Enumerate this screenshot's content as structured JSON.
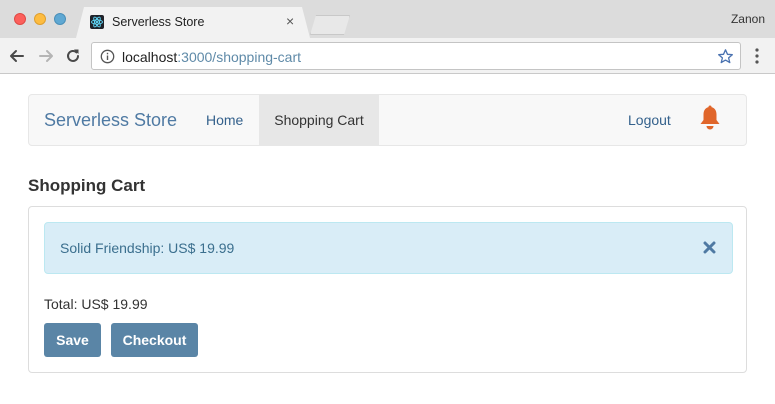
{
  "browser": {
    "tab_title": "Serverless Store",
    "tab_close_glyph": "×",
    "profile_name": "Zanon",
    "url_host": "localhost",
    "url_rest": ":3000/shopping-cart",
    "icons": [
      "back-arrow-icon",
      "forward-arrow-icon",
      "reload-icon",
      "info-icon",
      "star-icon",
      "menu-icon"
    ]
  },
  "navbar": {
    "brand": "Serverless Store",
    "items": [
      {
        "label": "Home",
        "active": false
      },
      {
        "label": "Shopping Cart",
        "active": true
      }
    ],
    "logout_label": "Logout",
    "notification_icon": "bell-icon",
    "bell_color": "#e0662b"
  },
  "page": {
    "heading": "Shopping Cart",
    "cart_items": [
      {
        "label": "Solid Friendship: US$ 19.99"
      }
    ],
    "total": "Total: US$ 19.99",
    "buttons": {
      "save": "Save",
      "checkout": "Checkout"
    }
  },
  "colors": {
    "brand": "#4f7aa3",
    "button": "#5a85a6",
    "alert_bg": "#d9edf7",
    "alert_text": "#3b6f8e"
  }
}
